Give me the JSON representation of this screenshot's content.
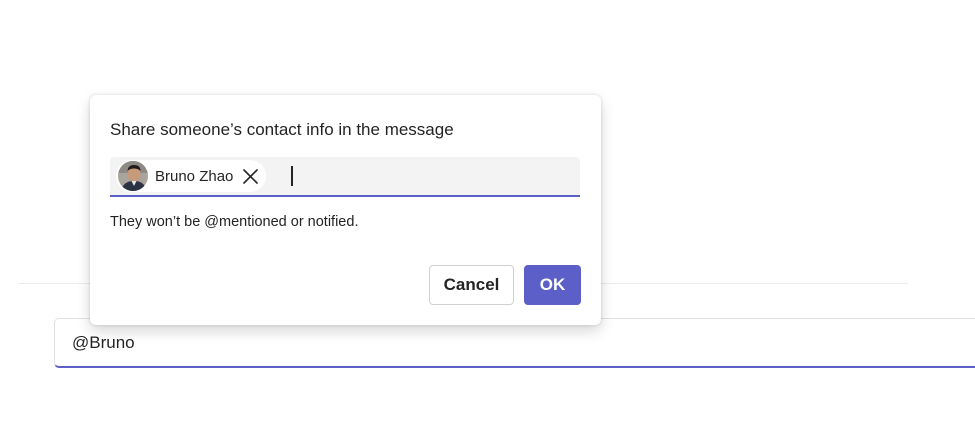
{
  "compose": {
    "value": "@Bruno"
  },
  "dialog": {
    "title": "Share someone’s contact info in the message",
    "picker": {
      "chip": {
        "name": "Bruno Zhao",
        "avatar_icon": "person-photo-icon",
        "remove_icon": "close-icon"
      }
    },
    "note": "They won’t be @mentioned or notified.",
    "buttons": {
      "cancel_label": "Cancel",
      "ok_label": "OK"
    }
  },
  "colors": {
    "accent": "#5b5fc7",
    "picker_background": "#f3f3f3",
    "text": "#242424"
  }
}
